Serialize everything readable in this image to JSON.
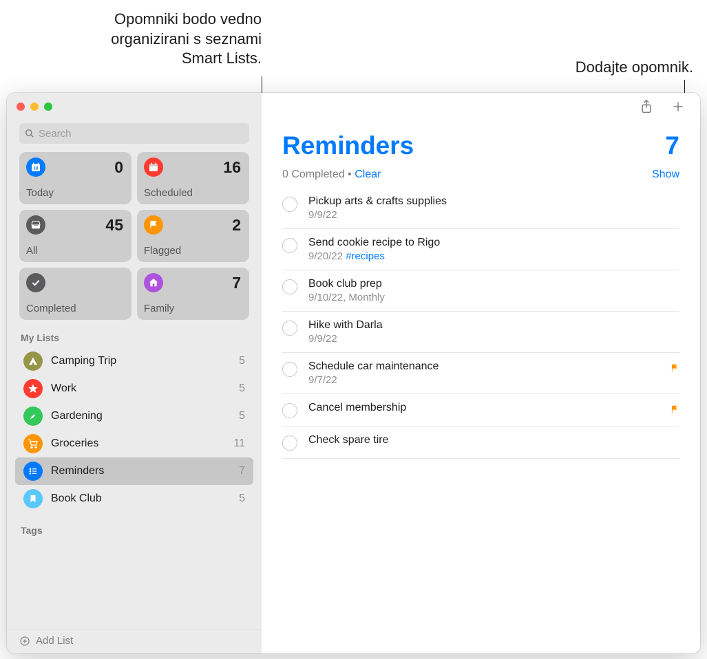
{
  "annotations": {
    "smart_lists": "Opomniki bodo vedno organizirani s seznami Smart Lists.",
    "add_reminder": "Dodajte opomnik."
  },
  "search": {
    "placeholder": "Search"
  },
  "smart_lists": {
    "today": {
      "label": "Today",
      "count": "0"
    },
    "scheduled": {
      "label": "Scheduled",
      "count": "16"
    },
    "all": {
      "label": "All",
      "count": "45"
    },
    "flagged": {
      "label": "Flagged",
      "count": "2"
    },
    "completed": {
      "label": "Completed",
      "count": ""
    },
    "family": {
      "label": "Family",
      "count": "7"
    }
  },
  "my_lists": {
    "header": "My Lists",
    "items": [
      {
        "label": "Camping Trip",
        "count": "5"
      },
      {
        "label": "Work",
        "count": "5"
      },
      {
        "label": "Gardening",
        "count": "5"
      },
      {
        "label": "Groceries",
        "count": "11"
      },
      {
        "label": "Reminders",
        "count": "7"
      },
      {
        "label": "Book Club",
        "count": "5"
      }
    ]
  },
  "tags": {
    "header": "Tags"
  },
  "footer": {
    "add_list": "Add List"
  },
  "main": {
    "title": "Reminders",
    "count": "7",
    "completed_text": "0 Completed",
    "dot": "  •  ",
    "clear": "Clear",
    "show": "Show",
    "reminders": [
      {
        "title": "Pickup arts & crafts supplies",
        "meta": "9/9/22",
        "tag": "",
        "flagged": false
      },
      {
        "title": "Send cookie recipe to Rigo",
        "meta": "9/20/22 ",
        "tag": "#recipes",
        "flagged": false
      },
      {
        "title": "Book club prep",
        "meta": "9/10/22, Monthly",
        "tag": "",
        "flagged": false
      },
      {
        "title": "Hike with Darla",
        "meta": "9/9/22",
        "tag": "",
        "flagged": false
      },
      {
        "title": "Schedule car maintenance",
        "meta": "9/7/22",
        "tag": "",
        "flagged": true
      },
      {
        "title": "Cancel membership",
        "meta": "",
        "tag": "",
        "flagged": true
      },
      {
        "title": "Check spare tire",
        "meta": "",
        "tag": "",
        "flagged": false
      }
    ]
  }
}
